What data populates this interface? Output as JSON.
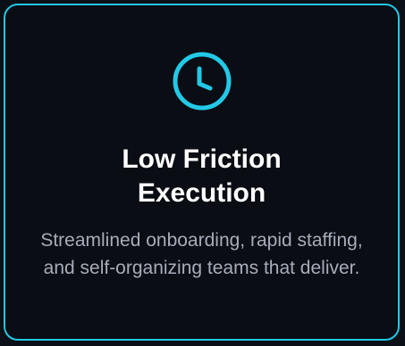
{
  "card": {
    "icon": "clock-icon",
    "accent_color": "#22c9e6",
    "title": "Low Friction Execution",
    "description": "Streamlined onboarding, rapid staffing, and self-organizing teams that deliver."
  }
}
